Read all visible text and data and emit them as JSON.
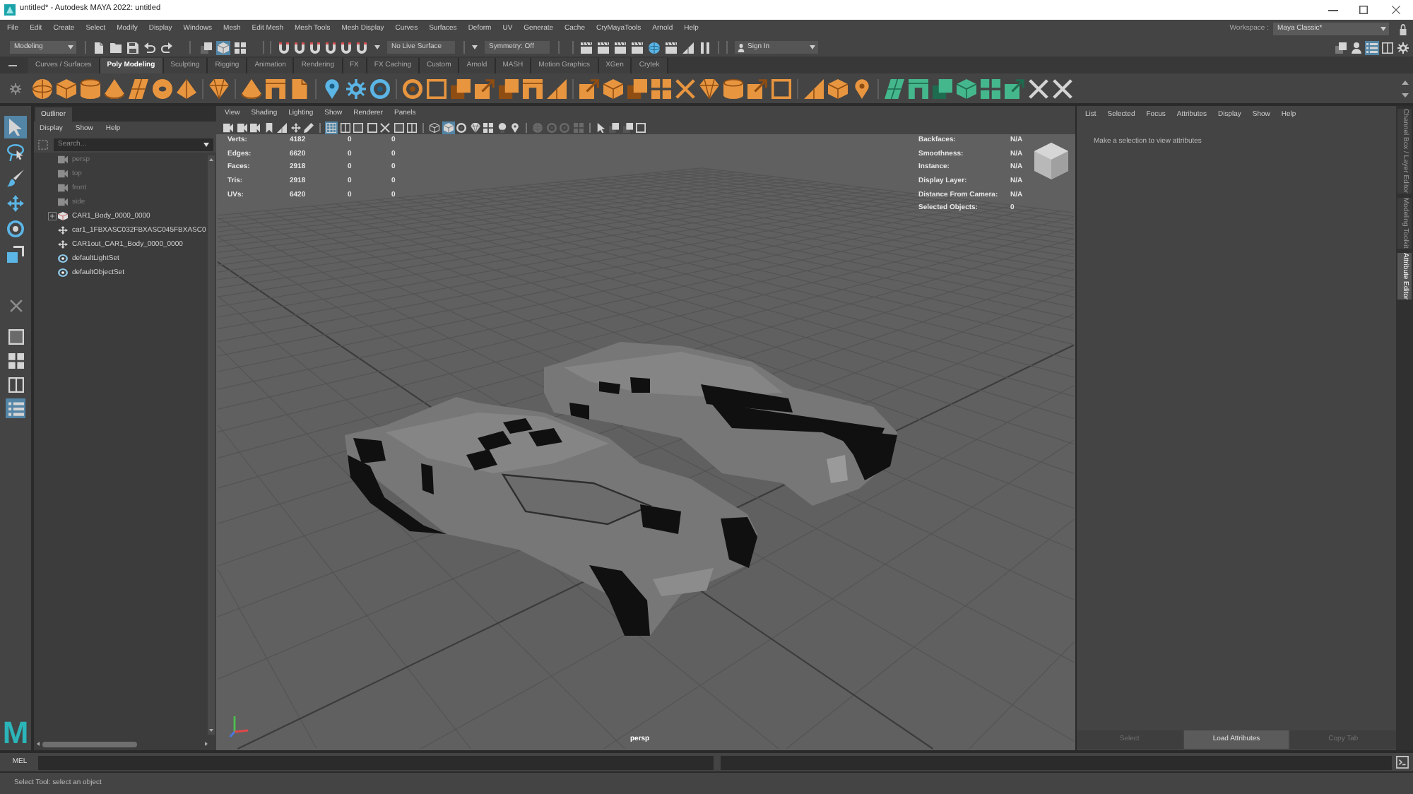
{
  "window": {
    "title": "untitled* - Autodesk MAYA 2022: untitled"
  },
  "menu_bar": {
    "menus": [
      "File",
      "Edit",
      "Create",
      "Select",
      "Modify",
      "Display",
      "Windows",
      "Mesh",
      "Edit Mesh",
      "Mesh Tools",
      "Mesh Display",
      "Curves",
      "Surfaces",
      "Deform",
      "UV",
      "Generate",
      "Cache",
      "CryMayaTools",
      "Arnold",
      "Help"
    ],
    "workspace_label": "Workspace :",
    "workspace": "Maya Classic*"
  },
  "status_line": {
    "menu_set": "Modeling",
    "select_modes": [
      {
        "selected": false
      },
      {
        "selected": true
      },
      {
        "selected": false
      }
    ],
    "live_surface": "No Live Surface",
    "symmetry": "Symmetry: Off",
    "sign_in": "Sign In",
    "panel_toggles": [
      {
        "selected": false
      },
      {
        "selected": false
      },
      {
        "selected": true
      },
      {
        "selected": false
      },
      {
        "selected": false
      }
    ]
  },
  "shelf": {
    "tabs": [
      {
        "label": "Curves / Surfaces",
        "selected": false
      },
      {
        "label": "Poly Modeling",
        "selected": true
      },
      {
        "label": "Sculpting",
        "selected": false
      },
      {
        "label": "Rigging",
        "selected": false
      },
      {
        "label": "Animation",
        "selected": false
      },
      {
        "label": "Rendering",
        "selected": false
      },
      {
        "label": "FX",
        "selected": false
      },
      {
        "label": "FX Caching",
        "selected": false
      },
      {
        "label": "Custom",
        "selected": false
      },
      {
        "label": "Arnold",
        "selected": false
      },
      {
        "label": "MASH",
        "selected": false
      },
      {
        "label": "Motion Graphics",
        "selected": false
      },
      {
        "label": "XGen",
        "selected": false
      },
      {
        "label": "Crytek",
        "selected": false
      }
    ]
  },
  "toolbox": {
    "tools": [
      {
        "selected": true
      },
      {
        "selected": false
      },
      {
        "selected": false
      },
      {
        "selected": false
      },
      {
        "selected": false
      },
      {
        "selected": false
      }
    ],
    "layouts": [
      {
        "selected": false
      },
      {
        "selected": false
      },
      {
        "selected": false
      },
      {
        "selected": true
      }
    ],
    "logo": "M"
  },
  "outliner": {
    "tab": "Outliner",
    "menus": [
      "Display",
      "Show",
      "Help"
    ],
    "search": {
      "placeholder": "Search..."
    },
    "items": [
      {
        "kind": "camera",
        "label": "persp",
        "dimmed": true
      },
      {
        "kind": "camera",
        "label": "top",
        "dimmed": true
      },
      {
        "kind": "camera",
        "label": "front",
        "dimmed": true
      },
      {
        "kind": "camera",
        "label": "side",
        "dimmed": true
      },
      {
        "kind": "mesh",
        "label": "CAR1_Body_0000_0000",
        "dimmed": false,
        "expanded": false
      },
      {
        "kind": "transform",
        "label": "car1_1FBXASC032FBXASC045FBXASC0",
        "dimmed": false
      },
      {
        "kind": "transform",
        "label": "CAR1out_CAR1_Body_0000_0000",
        "dimmed": false
      },
      {
        "kind": "set",
        "label": "defaultLightSet",
        "dimmed": false
      },
      {
        "kind": "set",
        "label": "defaultObjectSet",
        "dimmed": false
      }
    ]
  },
  "viewport": {
    "menus": [
      "View",
      "Shading",
      "Lighting",
      "Show",
      "Renderer",
      "Panels"
    ],
    "toolbar": [
      [
        {
          "selected": false,
          "disabled": false
        },
        {
          "selected": false,
          "disabled": false
        },
        {
          "selected": false,
          "disabled": false
        },
        {
          "selected": false,
          "disabled": false
        },
        {
          "selected": false,
          "disabled": false
        },
        {
          "selected": false,
          "disabled": false
        },
        {
          "selected": false,
          "disabled": false
        }
      ],
      [
        {
          "selected": true,
          "disabled": false
        },
        {
          "selected": false,
          "disabled": false
        },
        {
          "selected": false,
          "disabled": false
        },
        {
          "selected": false,
          "disabled": false
        },
        {
          "selected": false,
          "disabled": false
        },
        {
          "selected": false,
          "disabled": false
        },
        {
          "selected": false,
          "disabled": false
        }
      ],
      [
        {
          "selected": false,
          "disabled": false
        },
        {
          "selected": true,
          "disabled": false
        },
        {
          "selected": false,
          "disabled": false
        },
        {
          "selected": false,
          "disabled": false
        },
        {
          "selected": false,
          "disabled": false
        },
        {
          "selected": false,
          "disabled": false
        },
        {
          "selected": false,
          "disabled": false
        }
      ],
      [
        {
          "selected": false,
          "disabled": true
        },
        {
          "selected": false,
          "disabled": true
        },
        {
          "selected": false,
          "disabled": true
        },
        {
          "selected": false,
          "disabled": true
        }
      ],
      [
        {
          "selected": false,
          "disabled": false
        },
        {
          "selected": false,
          "disabled": false
        },
        {
          "selected": false,
          "disabled": false
        },
        {
          "selected": false,
          "disabled": false
        }
      ]
    ],
    "hud_stats": [
      {
        "label": "Verts:",
        "values": [
          "4182",
          "0",
          "0"
        ]
      },
      {
        "label": "Edges:",
        "values": [
          "6620",
          "0",
          "0"
        ]
      },
      {
        "label": "Faces:",
        "values": [
          "2918",
          "0",
          "0"
        ]
      },
      {
        "label": "Tris:",
        "values": [
          "2918",
          "0",
          "0"
        ]
      },
      {
        "label": "UVs:",
        "values": [
          "6420",
          "0",
          "0"
        ]
      }
    ],
    "hud_info": [
      {
        "label": "Backfaces:",
        "value": "N/A"
      },
      {
        "label": "Smoothness:",
        "value": "N/A"
      },
      {
        "label": "Instance:",
        "value": "N/A"
      },
      {
        "label": "Display Layer:",
        "value": "N/A"
      },
      {
        "label": "Distance From Camera:",
        "value": "N/A"
      },
      {
        "label": "Selected Objects:",
        "value": "0"
      }
    ],
    "camera": "persp"
  },
  "attribute_editor": {
    "menus": [
      "List",
      "Selected",
      "Focus",
      "Attributes",
      "Display",
      "Show",
      "Help"
    ],
    "message": "Make a selection to view attributes",
    "buttons": [
      {
        "label": "Select",
        "disabled": true
      },
      {
        "label": "Load Attributes",
        "disabled": false
      },
      {
        "label": "Copy Tab",
        "disabled": true
      }
    ]
  },
  "side_tabs": [
    {
      "label": "Channel Box / Layer Editor",
      "selected": false
    },
    {
      "label": "Modeling Toolkit",
      "selected": false
    },
    {
      "label": "Attribute Editor",
      "selected": true
    }
  ],
  "command_line": {
    "language": "MEL"
  },
  "help_line": {
    "text": "Select Tool: select an object"
  }
}
